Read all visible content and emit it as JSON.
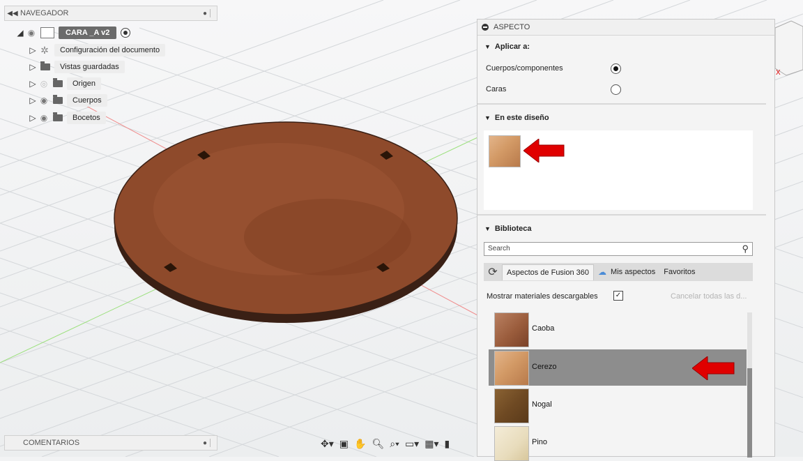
{
  "browser": {
    "title": "NAVEGADOR",
    "component_label": "CARA _A v2",
    "items": [
      {
        "label": "Configuración del documento"
      },
      {
        "label": "Vistas guardadas"
      },
      {
        "label": "Origen"
      },
      {
        "label": "Cuerpos"
      },
      {
        "label": "Bocetos"
      }
    ]
  },
  "comments": {
    "title": "COMENTARIOS"
  },
  "appearance": {
    "title": "ASPECTO",
    "apply_to": {
      "title": "Aplicar a:",
      "options": [
        {
          "label": "Cuerpos/componentes",
          "selected": true
        },
        {
          "label": "Caras",
          "selected": false
        }
      ]
    },
    "in_design": {
      "title": "En este diseño"
    },
    "library": {
      "title": "Biblioteca",
      "search_placeholder": "Search",
      "tabs": [
        "Aspectos de Fusion 360",
        "Mis aspectos",
        "Favoritos"
      ],
      "show_downloadable": "Mostrar materiales descargables",
      "show_downloadable_checked": true,
      "cancel_all": "Cancelar todas las d...",
      "items": [
        {
          "label": "Caoba"
        },
        {
          "label": "Cerezo",
          "selected": true
        },
        {
          "label": "Nogal"
        },
        {
          "label": "Pino"
        }
      ]
    }
  },
  "colors": {
    "accent_arrow": "#e00000",
    "wood": "#8a4a2a"
  }
}
